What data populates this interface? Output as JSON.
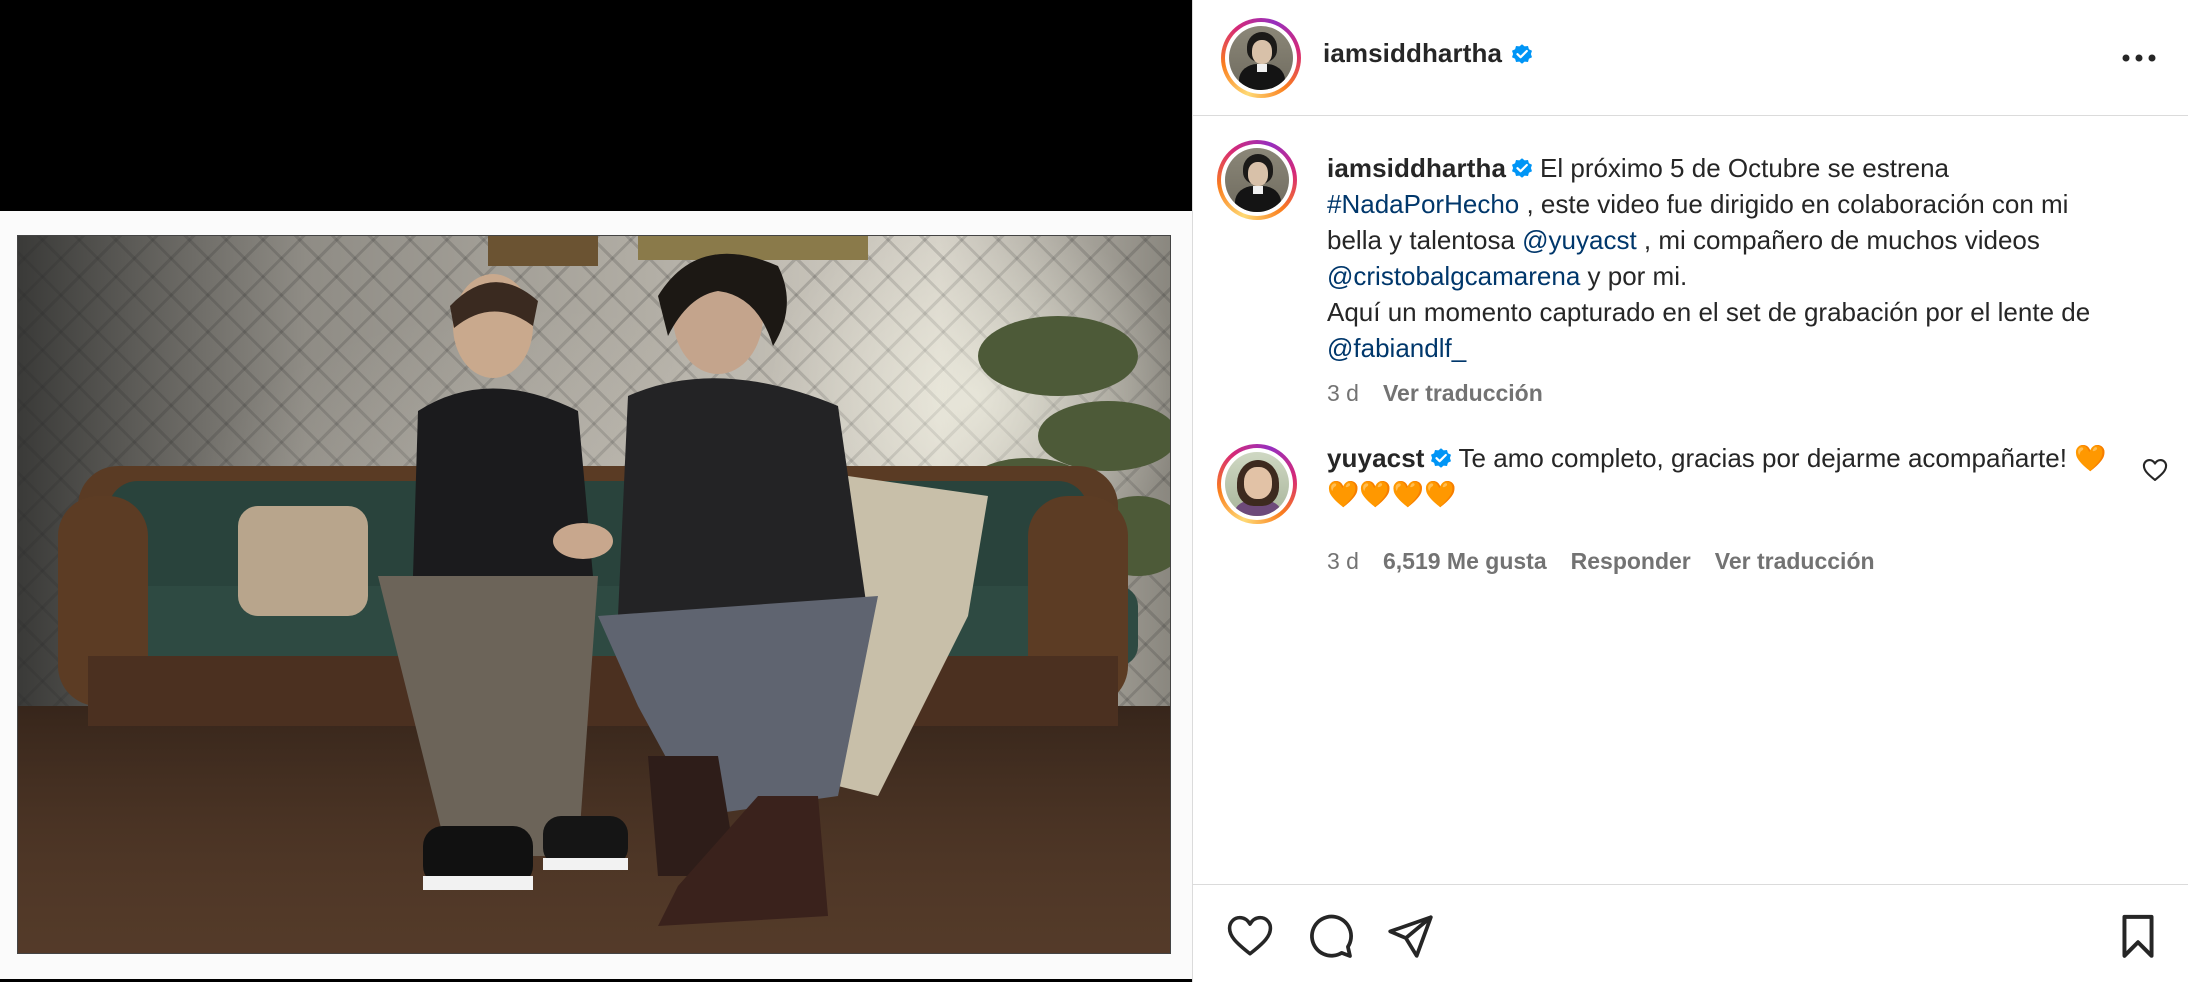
{
  "post": {
    "author": "iamsiddhartha",
    "verified": true
  },
  "caption": {
    "author": "iamsiddhartha",
    "line1": "El próximo 5 de Octubre se estrena",
    "hashtag": "#NadaPorHecho",
    "text2": ", este video fue dirigido en colaboración con mi bella y talentosa",
    "mention1": "@yuyacst",
    "text3": ", mi compañero de muchos videos",
    "mention2": "@cristobalgcamarena",
    "text4": "y por mi.",
    "line_b": "Aquí un momento capturado en el set de grabación por el lente de",
    "mention3": "@fabiandlf_",
    "time": "3 d",
    "translate": "Ver traducción"
  },
  "reply": {
    "author": "yuyacst",
    "text": "Te amo completo, gracias por dejarme acompañarte!",
    "emojis": "🧡🧡🧡🧡🧡",
    "time": "3 d",
    "likes": "6,519 Me gusta",
    "reply_btn": "Responder",
    "translate": "Ver traducción"
  },
  "icons": {
    "verified": "verified-badge-icon",
    "more": "more-horizontal-icon",
    "like": "heart-icon",
    "comment": "comment-bubble-icon",
    "share": "paper-plane-icon",
    "save": "bookmark-icon"
  },
  "colors": {
    "verified": "#0095f6",
    "link": "#00376b",
    "muted": "#737373",
    "text": "#262626"
  }
}
